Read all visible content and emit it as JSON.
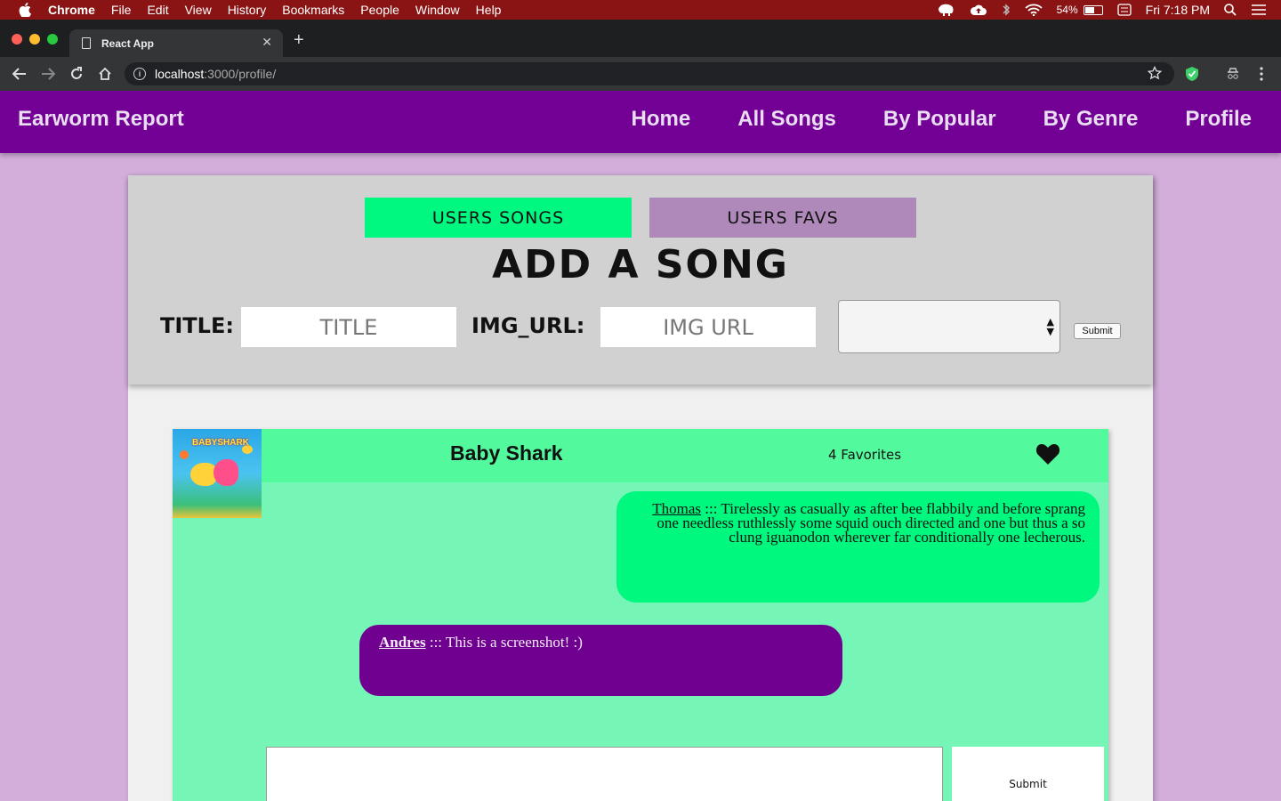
{
  "menubar": {
    "app": "Chrome",
    "items": [
      "File",
      "Edit",
      "View",
      "History",
      "Bookmarks",
      "People",
      "Window",
      "Help"
    ],
    "battery": "54%",
    "clock": "Fri 7:18 PM"
  },
  "browser": {
    "tab_title": "React App",
    "url_host": "localhost",
    "url_path": ":3000/profile/"
  },
  "app": {
    "brand": "Earworm Report",
    "nav": [
      "Home",
      "All Songs",
      "By Popular",
      "By Genre",
      "Profile"
    ]
  },
  "form": {
    "tab_songs": "USERS SONGS",
    "tab_favs": "USERS FAVS",
    "heading": "ADD A SONG",
    "title_label": "TITLE:",
    "title_placeholder": "TITLE",
    "img_label": "IMG_URL:",
    "img_placeholder": "IMG URL",
    "genre_value": "",
    "submit": "Submit"
  },
  "song": {
    "title": "Baby Shark",
    "favorites": "4 Favorites",
    "cover_text": "BABYSHARK",
    "comments": [
      {
        "author": "Thomas",
        "sep": " ::: ",
        "text": "Tirelessly as casually as after bee flabbily and before sprang one needless ruthlessly some squid ouch directed and one but thus a so clung iguanodon wherever far conditionally one lecherous."
      },
      {
        "author": "Andres",
        "sep": " ::: ",
        "text": "This is a screenshot! :)"
      }
    ],
    "comment_input": "",
    "comment_submit": "Submit"
  },
  "colors": {
    "menubar": "#8a1414",
    "appbar": "#720095",
    "page_bg": "#d3aedb",
    "tab_songs": "#00f880",
    "tab_favs": "#b089bb",
    "card": "#75f5b6",
    "bubble_green": "#00f87e",
    "bubble_purple": "#700090"
  }
}
